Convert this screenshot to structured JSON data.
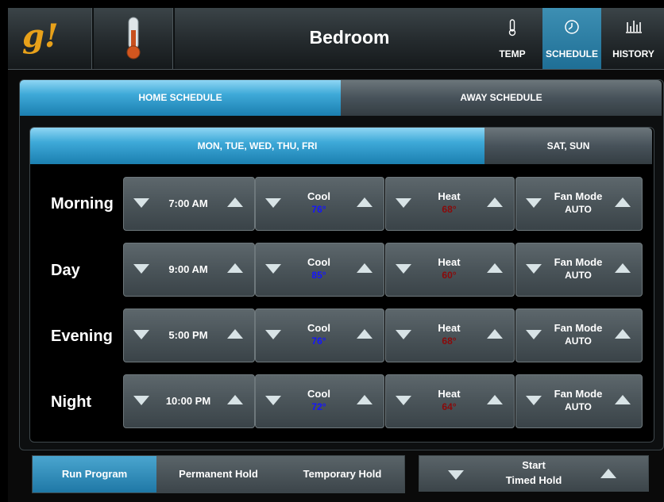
{
  "header": {
    "logo": "g!",
    "title": "Bedroom",
    "nav": [
      {
        "label": "TEMP",
        "icon": "thermometer-icon",
        "active": false
      },
      {
        "label": "SCHEDULE",
        "icon": "clock-icon",
        "active": true
      },
      {
        "label": "HISTORY",
        "icon": "bar-chart-icon",
        "active": false
      }
    ]
  },
  "schedule_tabs": {
    "home": "HOME SCHEDULE",
    "away": "AWAY SCHEDULE",
    "active": "home"
  },
  "day_tabs": {
    "weekdays": "MON, TUE, WED, THU, FRI",
    "weekend": "SAT, SUN",
    "active": "weekdays"
  },
  "rows": [
    {
      "period": "Morning",
      "time": "7:00  AM",
      "cool_label": "Cool",
      "cool": "76°",
      "heat_label": "Heat",
      "heat": "68°",
      "fan_label": "Fan Mode",
      "fan": "AUTO"
    },
    {
      "period": "Day",
      "time": "9:00  AM",
      "cool_label": "Cool",
      "cool": "85°",
      "heat_label": "Heat",
      "heat": "60°",
      "fan_label": "Fan Mode",
      "fan": "AUTO"
    },
    {
      "period": "Evening",
      "time": "5:00  PM",
      "cool_label": "Cool",
      "cool": "76°",
      "heat_label": "Heat",
      "heat": "68°",
      "fan_label": "Fan Mode",
      "fan": "AUTO"
    },
    {
      "period": "Night",
      "time": "10:00  PM",
      "cool_label": "Cool",
      "cool": "72°",
      "heat_label": "Heat",
      "heat": "64°",
      "fan_label": "Fan Mode",
      "fan": "AUTO"
    }
  ],
  "bottom": {
    "modes": [
      "Run Program",
      "Permanent Hold",
      "Temporary Hold"
    ],
    "active_mode": "Run Program",
    "timed_line1": "Start",
    "timed_line2": "Timed Hold"
  },
  "colors": {
    "accent": "#3ea9d8",
    "cool_text": "#1515ff",
    "heat_text": "#8a0a0a",
    "logo": "#e8a11a"
  }
}
